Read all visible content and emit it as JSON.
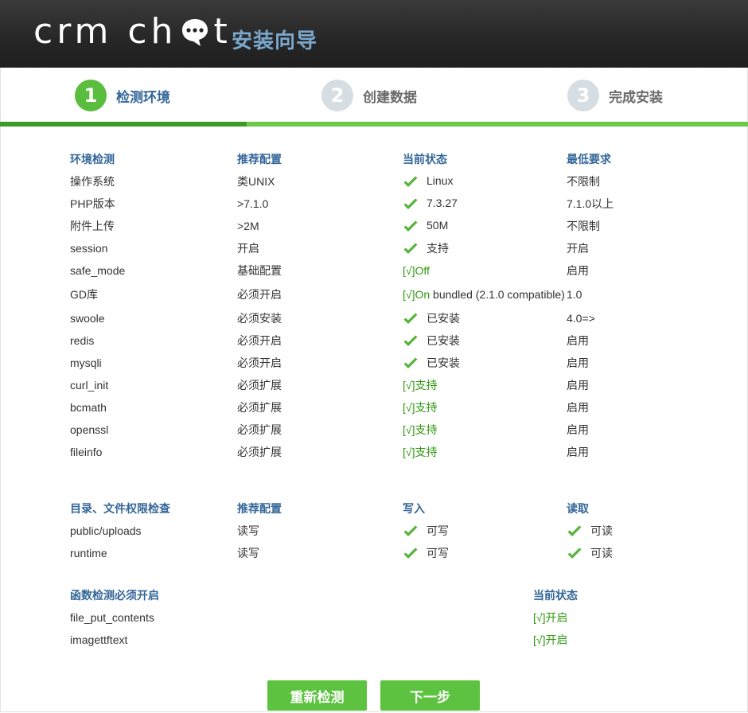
{
  "header": {
    "logo_text_left": "crm ch",
    "logo_text_right": "t",
    "title": "安装向导",
    "icons": [
      "chat-bubble-icon"
    ]
  },
  "steps": [
    {
      "number": "1",
      "label": "检测环境",
      "state": "active"
    },
    {
      "number": "2",
      "label": "创建数据",
      "state": "inactive"
    },
    {
      "number": "3",
      "label": "完成安装",
      "state": "inactive"
    }
  ],
  "colors": {
    "accent_green": "#5bbd3d",
    "heading_blue": "#336699",
    "ok_green": "#2e9a0e",
    "header_bg": "#262626"
  },
  "env": {
    "headers": [
      "环境检测",
      "推荐配置",
      "当前状态",
      "最低要求"
    ],
    "rows": [
      {
        "name": "操作系统",
        "recommended": "类UNIX",
        "status": "Linux",
        "check": true,
        "minimum": "不限制"
      },
      {
        "name": "PHP版本",
        "recommended": ">7.1.0",
        "status": "7.3.27",
        "check": true,
        "minimum": "7.1.0以上"
      },
      {
        "name": "附件上传",
        "recommended": ">2M",
        "status": "50M",
        "check": true,
        "minimum": "不限制"
      },
      {
        "name": "session",
        "recommended": "开启",
        "status": "支持",
        "check": true,
        "minimum": "开启"
      },
      {
        "name": "safe_mode",
        "recommended": "基础配置",
        "status_ok": "[√]Off",
        "status_rest": "",
        "minimum": "启用"
      },
      {
        "name": "GD库",
        "recommended": "必须开启",
        "status_ok": "[√]On",
        "status_rest": " bundled (2.1.0 compatible)",
        "minimum": "1.0"
      },
      {
        "name": "swoole",
        "recommended": "必须安装",
        "status": "已安装",
        "check": true,
        "minimum": "4.0=>"
      },
      {
        "name": "redis",
        "recommended": "必须开启",
        "status": "已安装",
        "check": true,
        "minimum": "启用"
      },
      {
        "name": "mysqli",
        "recommended": "必须开启",
        "status": "已安装",
        "check": true,
        "minimum": "启用"
      },
      {
        "name": "curl_init",
        "recommended": "必须扩展",
        "status_ok": "[√]支持",
        "status_rest": "",
        "minimum": "启用"
      },
      {
        "name": "bcmath",
        "recommended": "必须扩展",
        "status_ok": "[√]支持",
        "status_rest": "",
        "minimum": "启用"
      },
      {
        "name": "openssl",
        "recommended": "必须扩展",
        "status_ok": "[√]支持",
        "status_rest": "",
        "minimum": "启用"
      },
      {
        "name": "fileinfo",
        "recommended": "必须扩展",
        "status_ok": "[√]支持",
        "status_rest": "",
        "minimum": "启用"
      }
    ]
  },
  "dirs": {
    "headers": [
      "目录、文件权限检查",
      "推荐配置",
      "写入",
      "读取"
    ],
    "rows": [
      {
        "path": "public/uploads",
        "recommended": "读写",
        "write": "可写",
        "read": "可读"
      },
      {
        "path": "runtime",
        "recommended": "读写",
        "write": "可写",
        "read": "可读"
      }
    ]
  },
  "funcs": {
    "headers": [
      "函数检测必须开启",
      "当前状态"
    ],
    "rows": [
      {
        "name": "file_put_contents",
        "status": "[√]开启"
      },
      {
        "name": "imagettftext",
        "status": "[√]开启"
      }
    ]
  },
  "buttons": {
    "recheck": "重新检测",
    "next": "下一步"
  }
}
